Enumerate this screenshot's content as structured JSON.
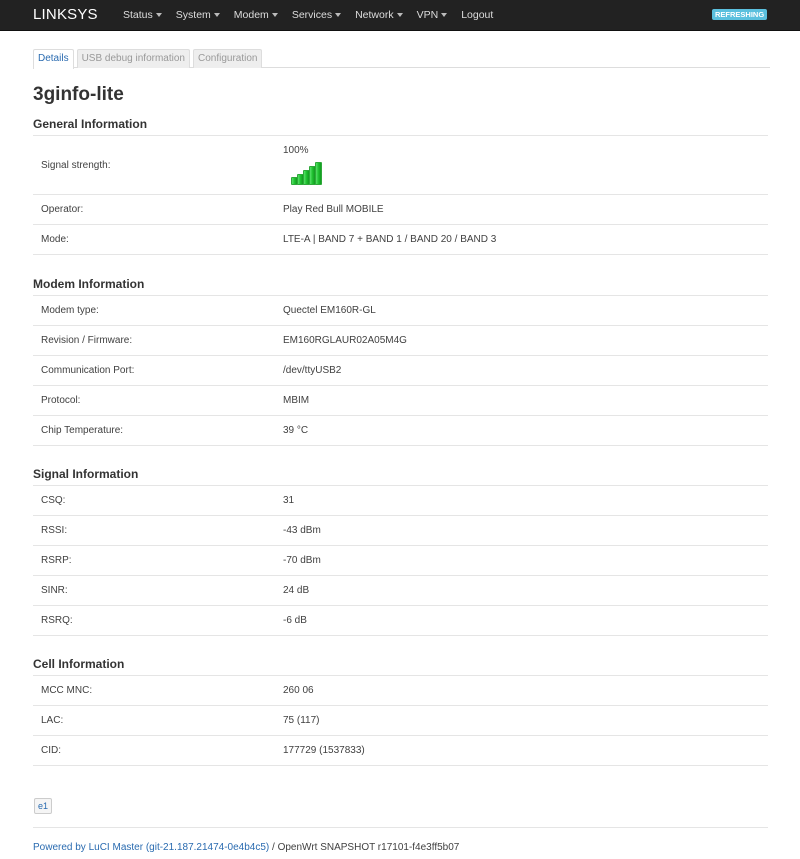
{
  "navbar": {
    "brand": "LINKSYS",
    "menu": [
      {
        "label": "Status",
        "dropdown": true
      },
      {
        "label": "System",
        "dropdown": true
      },
      {
        "label": "Modem",
        "dropdown": true
      },
      {
        "label": "Services",
        "dropdown": true
      },
      {
        "label": "Network",
        "dropdown": true
      },
      {
        "label": "VPN",
        "dropdown": true
      },
      {
        "label": "Logout",
        "dropdown": false
      }
    ],
    "status_badge": "REFRESHING"
  },
  "tabs": [
    {
      "label": "Details",
      "active": true
    },
    {
      "label": "USB debug information",
      "active": false
    },
    {
      "label": "Configuration",
      "active": false
    }
  ],
  "page_title": "3ginfo-lite",
  "general": {
    "title": "General Information",
    "signal_label": "Signal strength:",
    "signal_value": "100%",
    "signal_bars_filled": 5,
    "signal_bars_total": 5,
    "operator_label": "Operator:",
    "operator_value": "Play Red Bull MOBILE",
    "mode_label": "Mode:",
    "mode_value": "LTE-A | BAND 7 + BAND 1 / BAND 20 / BAND 3"
  },
  "modem": {
    "title": "Modem Information",
    "rows": [
      {
        "label": "Modem type:",
        "value": "Quectel EM160R-GL"
      },
      {
        "label": "Revision / Firmware:",
        "value": "EM160RGLAUR02A05M4G"
      },
      {
        "label": "Communication Port:",
        "value": "/dev/ttyUSB2"
      },
      {
        "label": "Protocol:",
        "value": "MBIM"
      },
      {
        "label": "Chip Temperature:",
        "value": "39 °C"
      }
    ]
  },
  "signal": {
    "title": "Signal Information",
    "rows": [
      {
        "label": "CSQ:",
        "value": "31"
      },
      {
        "label": "RSSI:",
        "value": "-43 dBm"
      },
      {
        "label": "RSRP:",
        "value": "-70 dBm"
      },
      {
        "label": "SINR:",
        "value": "24 dB"
      },
      {
        "label": "RSRQ:",
        "value": "-6 dB"
      }
    ]
  },
  "cell": {
    "title": "Cell Information",
    "rows": [
      {
        "label": "MCC MNC:",
        "value": "260 06"
      },
      {
        "label": "LAC:",
        "value": "75 (117)"
      },
      {
        "label": "CID:",
        "value": "177729 (1537833)"
      }
    ]
  },
  "e1_button": "e1",
  "footer": {
    "powered_link": "Powered by LuCI Master (git-21.187.21474-0e4b4c5)",
    "separator": " / ",
    "version": "OpenWrt SNAPSHOT r17101-f4e3ff5b07"
  },
  "colors": {
    "navbar_bg": "#222222",
    "link": "#2a6bb0",
    "badge": "#5bc0de",
    "signal_green": "#1fc02f"
  }
}
